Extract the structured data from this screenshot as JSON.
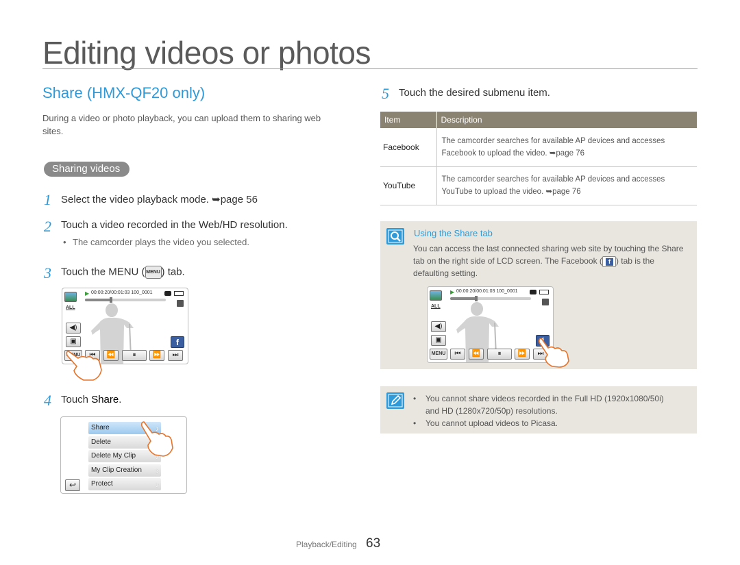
{
  "page": {
    "title": "Editing videos or photos",
    "section_heading": "Share (HMX-QF20 only)",
    "intro": "During a video or photo playback, you can upload them to sharing web sites.",
    "subsection_pill": "Sharing videos"
  },
  "steps": [
    {
      "num": "1",
      "text": "Select the video playback mode. ➥page 56"
    },
    {
      "num": "2",
      "text": "Touch a video recorded in the Web/HD resolution.",
      "bullet": "The camcorder plays the video you selected."
    },
    {
      "num": "3",
      "text_before": "Touch the MENU (",
      "key": "MENU",
      "text_after": ") tab."
    },
    {
      "num": "4",
      "text_before": "Touch ",
      "bold": "Share",
      "text_after": "."
    },
    {
      "num": "5",
      "text": "Touch the desired submenu item."
    }
  ],
  "lcd": {
    "timecode": "00:00:20/00:01:03   100_0001",
    "all_label": "ALL",
    "menu_label": "MENU",
    "facebook_glyph": "f",
    "progress_fraction": 0.32
  },
  "submenu": {
    "items": [
      "Share",
      "Delete",
      "Delete My Clip",
      "My Clip Creation",
      "Protect"
    ]
  },
  "table": {
    "headers": [
      "Item",
      "Description"
    ],
    "rows": [
      {
        "item": "Facebook",
        "description": "The camcorder searches for available AP devices and accesses Facebook to upload the video. ➥page 76"
      },
      {
        "item": "YouTube",
        "description": "The camcorder searches for available AP devices and accesses YouTube to upload the video. ➥page 76"
      }
    ]
  },
  "tip": {
    "title": "Using the Share tab",
    "text_before": "You can access the last connected sharing web site by touching the Share tab on the right side of LCD screen. The Facebook (",
    "text_after": ") tab is the defaulting setting."
  },
  "notes": [
    "You cannot share videos recorded in the Full HD (1920x1080/50i)",
    "and HD (1280x720/50p) resolutions.",
    "You cannot upload videos to Picasa."
  ],
  "footer": {
    "label": "Playback/Editing",
    "page": "63"
  },
  "colors": {
    "accent": "#2f9ad7",
    "table_header": "#8b8372",
    "tip_bg": "#e9e6df",
    "facebook": "#3b5ea0"
  }
}
